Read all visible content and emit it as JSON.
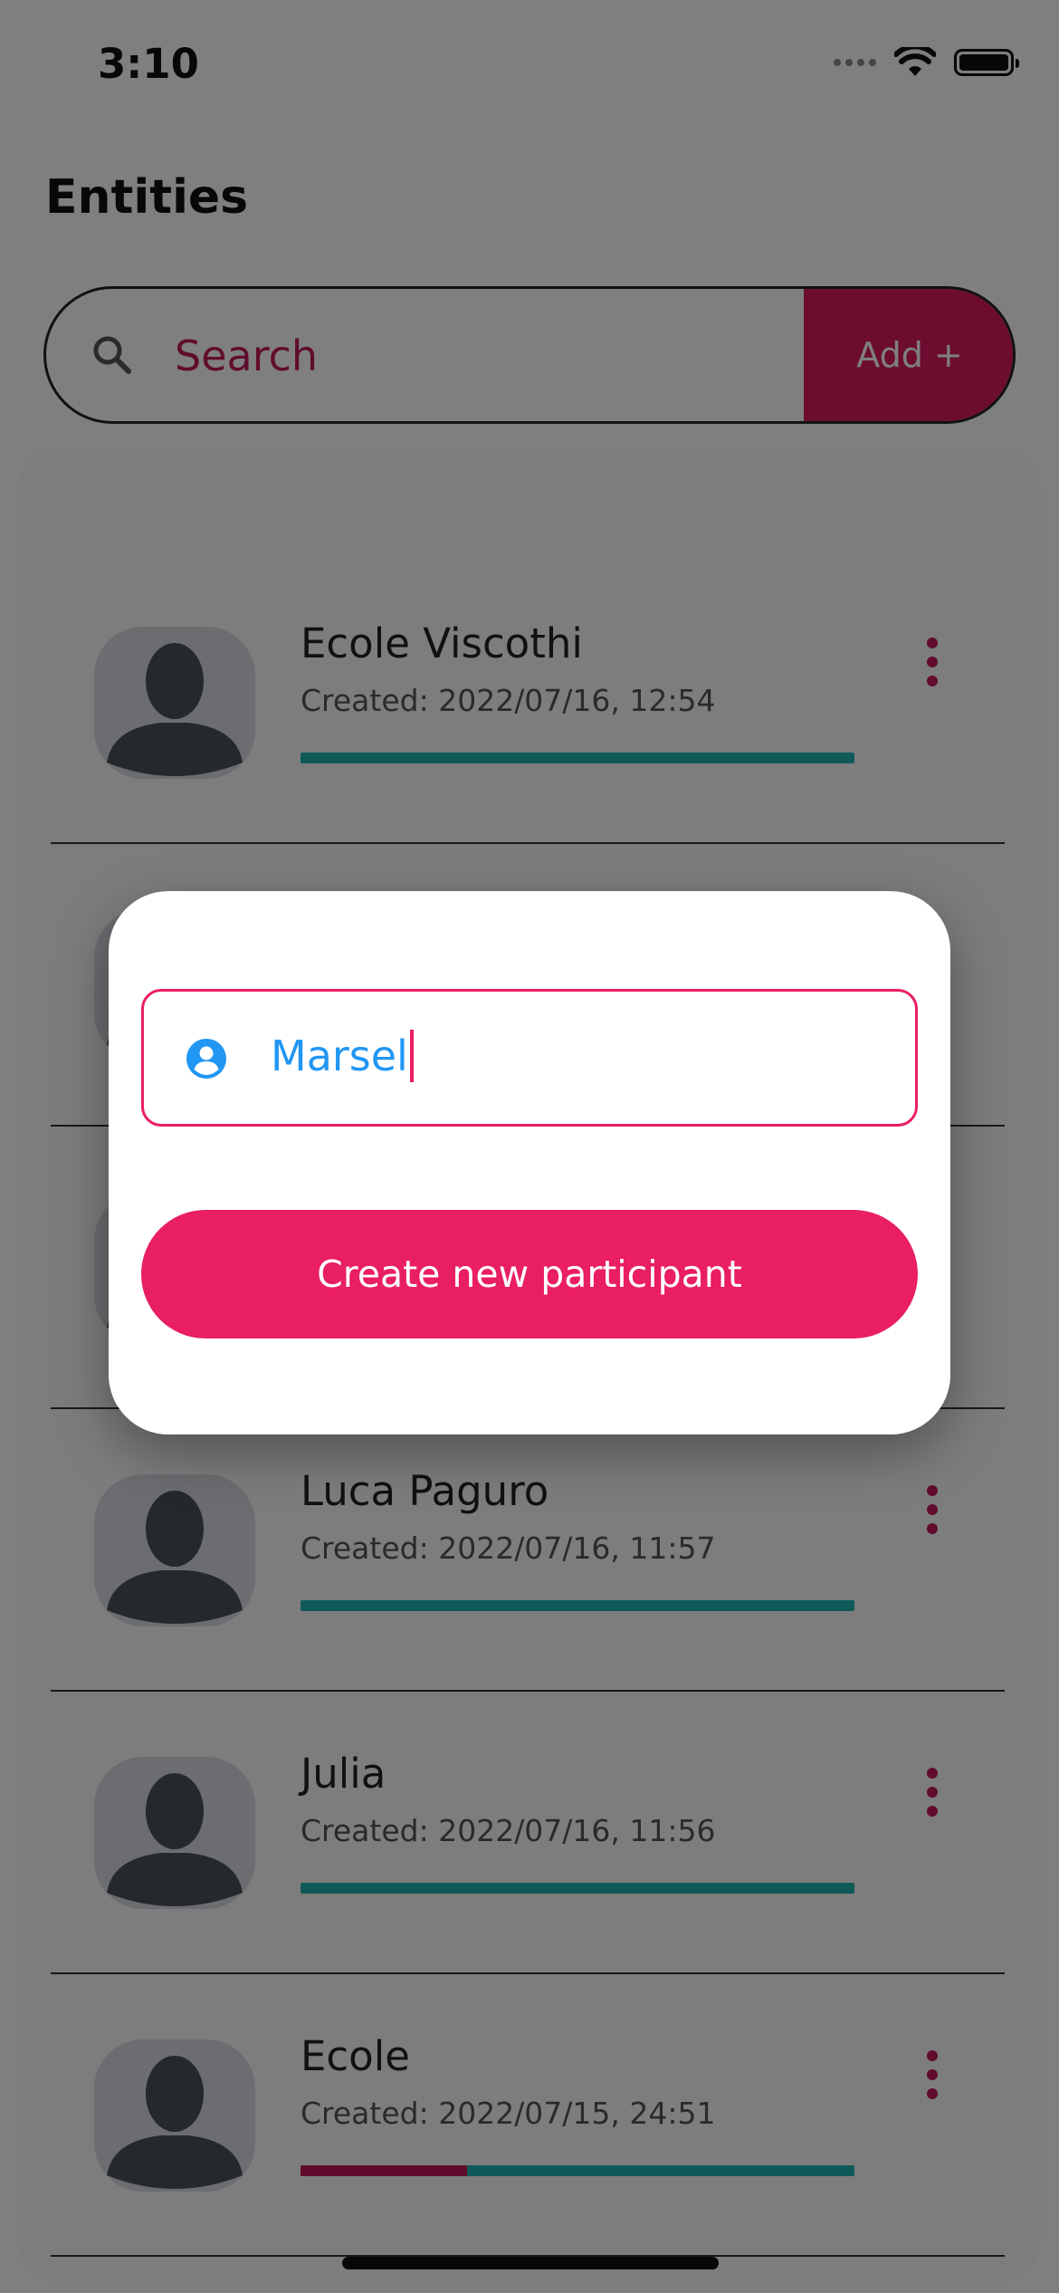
{
  "status_bar": {
    "time": "3:10"
  },
  "header": {
    "title": "Entities"
  },
  "search": {
    "placeholder": "Search",
    "add_label": "Add +"
  },
  "entities": [
    {
      "name": "Ecole Viscothi",
      "created": "Created:  2022/07/16, 12:54",
      "progress_accent": 0
    },
    {
      "name": "",
      "created": "",
      "progress_accent": 0
    },
    {
      "name": "",
      "created": "",
      "progress_accent": 0
    },
    {
      "name": "Luca Paguro",
      "created": "Created:  2022/07/16, 11:57",
      "progress_accent": 0
    },
    {
      "name": "Julia",
      "created": "Created:  2022/07/16, 11:56",
      "progress_accent": 0
    },
    {
      "name": "Ecole",
      "created": "Created:  2022/07/15, 24:51",
      "progress_accent": 0.3
    }
  ],
  "dialog": {
    "name_value": "Marsel",
    "create_button_label": "Create new participant"
  },
  "colors": {
    "accent": "#e91e63",
    "accent_dark": "#c2185b",
    "progress": "#1fb5b0",
    "input_text": "#2196f3"
  },
  "icons": {
    "search": "search-icon",
    "more": "more-vertical-icon",
    "avatar": "person-silhouette-icon",
    "user": "account-circle-icon"
  }
}
